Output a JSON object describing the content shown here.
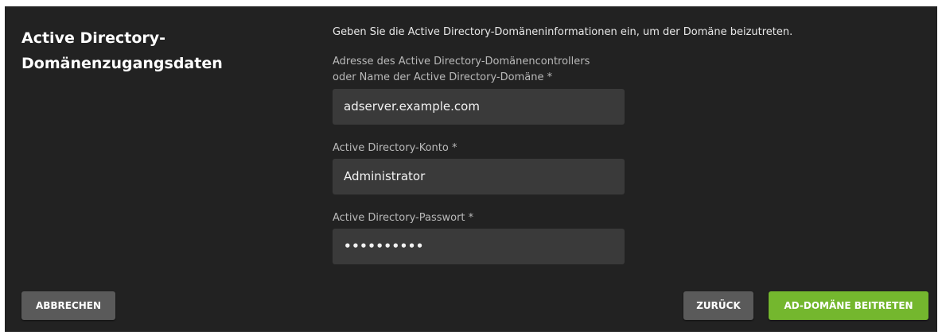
{
  "dialog": {
    "title_line1": "Active Directory-",
    "title_line2": "Domänenzugangsdaten",
    "intro": "Geben Sie die Active Directory-Domäneninformationen ein, um der Domäne beizutreten."
  },
  "fields": {
    "address": {
      "label_line1": "Adresse des Active Directory-Domänencontrollers",
      "label_line2": "oder Name der Active Directory-Domäne *",
      "value": "adserver.example.com"
    },
    "account": {
      "label": "Active Directory-Konto *",
      "value": "Administrator"
    },
    "password": {
      "label": "Active Directory-Passwort *",
      "value": "••••••••••"
    }
  },
  "buttons": {
    "cancel": "ABBRECHEN",
    "back": "ZURÜCK",
    "join": "AD-DOMÄNE BEITRETEN"
  },
  "colors": {
    "panel_background": "#222222",
    "input_background": "#3a3a3a",
    "secondary_button": "#5a5a5a",
    "primary_button": "#74b72e"
  }
}
